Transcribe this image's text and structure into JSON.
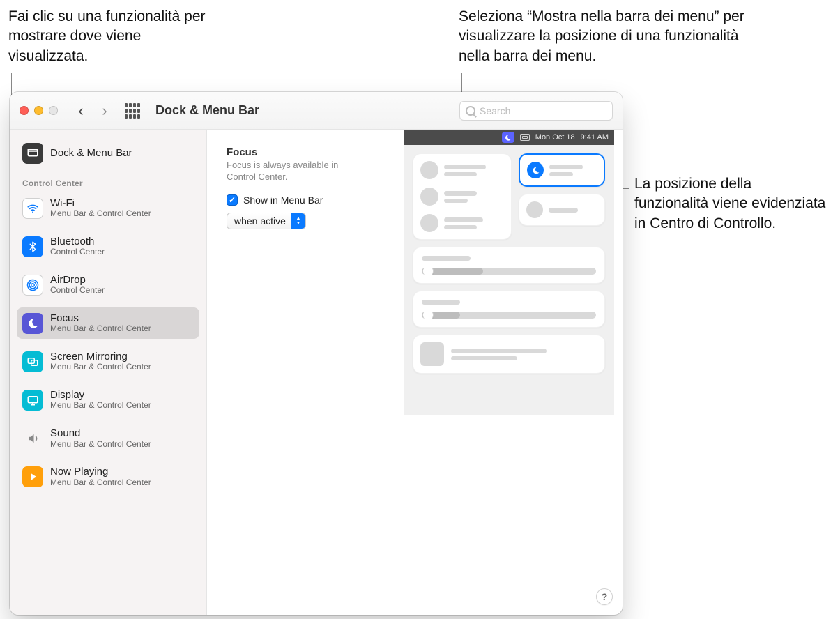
{
  "callouts": {
    "left": "Fai clic su una funzionalità per mostrare dove viene visualizzata.",
    "top_right": "Seleziona “Mostra nella barra dei menu” per visualizzare la posizione di una funzionalità nella barra dei menu.",
    "right": "La posizione della funzionalità viene evidenziata in Centro di Controllo."
  },
  "window": {
    "title": "Dock & Menu Bar",
    "search_placeholder": "Search"
  },
  "sidebar": {
    "top_item": {
      "label": "Dock & Menu Bar"
    },
    "section": "Control Center",
    "items": [
      {
        "label": "Wi-Fi",
        "sub": "Menu Bar & Control Center",
        "icon": "wifi"
      },
      {
        "label": "Bluetooth",
        "sub": "Control Center",
        "icon": "bt"
      },
      {
        "label": "AirDrop",
        "sub": "Control Center",
        "icon": "air"
      },
      {
        "label": "Focus",
        "sub": "Menu Bar & Control Center",
        "icon": "focus",
        "selected": true
      },
      {
        "label": "Screen Mirroring",
        "sub": "Menu Bar & Control Center",
        "icon": "mirror"
      },
      {
        "label": "Display",
        "sub": "Menu Bar & Control Center",
        "icon": "disp"
      },
      {
        "label": "Sound",
        "sub": "Menu Bar & Control Center",
        "icon": "sound"
      },
      {
        "label": "Now Playing",
        "sub": "Menu Bar & Control Center",
        "icon": "now"
      }
    ]
  },
  "pane": {
    "title": "Focus",
    "subtitle": "Focus is always available in Control Center.",
    "checkbox_label": "Show in Menu Bar",
    "checkbox_checked": true,
    "select_value": "when active"
  },
  "preview": {
    "menubar_date": "Mon Oct 18",
    "menubar_time": "9:41 AM"
  },
  "help_label": "?"
}
